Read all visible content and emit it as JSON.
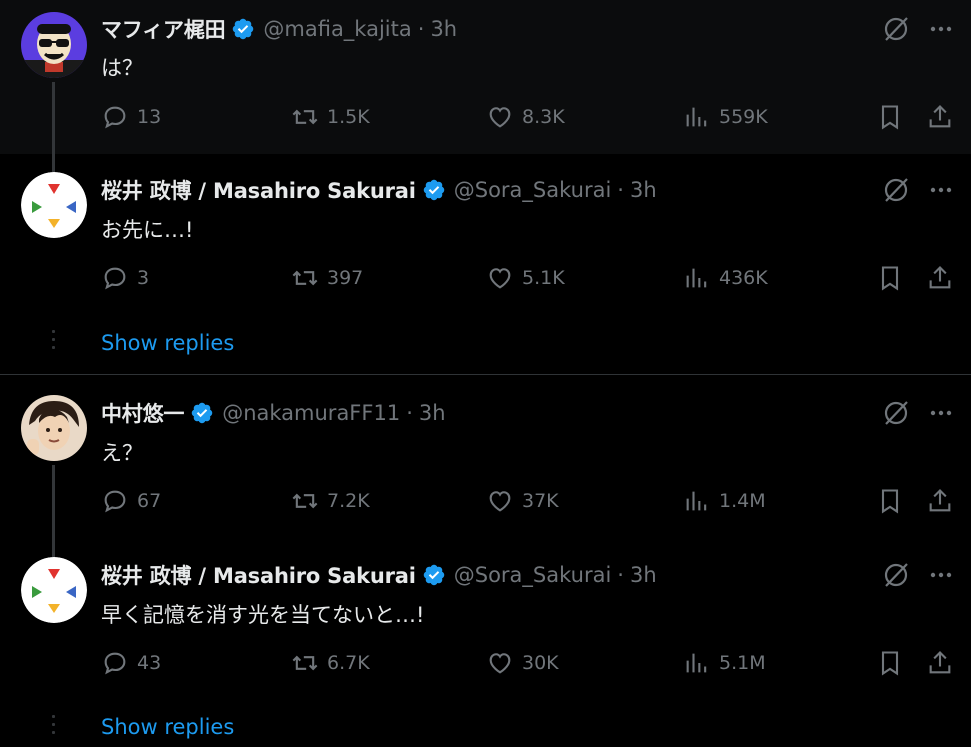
{
  "tweets": [
    {
      "name": "マフィア梶田",
      "handle": "@mafia_kajita",
      "sep": "·",
      "time": "3h",
      "text": "は？",
      "replies": "13",
      "retweets": "1.5K",
      "likes": "8.3K",
      "views": "559K"
    },
    {
      "name": "桜井 政博 / Masahiro Sakurai",
      "handle": "@Sora_Sakurai",
      "sep": "·",
      "time": "3h",
      "text": "お先に…!",
      "replies": "3",
      "retweets": "397",
      "likes": "5.1K",
      "views": "436K"
    },
    {
      "name": "中村悠一",
      "handle": "@nakamuraFF11",
      "sep": "·",
      "time": "3h",
      "text": "え？",
      "replies": "67",
      "retweets": "7.2K",
      "likes": "37K",
      "views": "1.4M"
    },
    {
      "name": "桜井 政博 / Masahiro Sakurai",
      "handle": "@Sora_Sakurai",
      "sep": "·",
      "time": "3h",
      "text": "早く記憶を消す光を当てないと…!",
      "replies": "43",
      "retweets": "6.7K",
      "likes": "30K",
      "views": "5.1M"
    }
  ],
  "show_replies_label": "Show replies",
  "colors": {
    "background": "#000000",
    "text": "#e7e9ea",
    "muted": "#71767b",
    "accent": "#1d9bf0",
    "verified": "#1d9bf0"
  },
  "icons": [
    "verified-badge-icon",
    "grok-icon",
    "more-icon",
    "reply-icon",
    "retweet-icon",
    "like-icon",
    "views-icon",
    "bookmark-icon",
    "share-icon"
  ]
}
